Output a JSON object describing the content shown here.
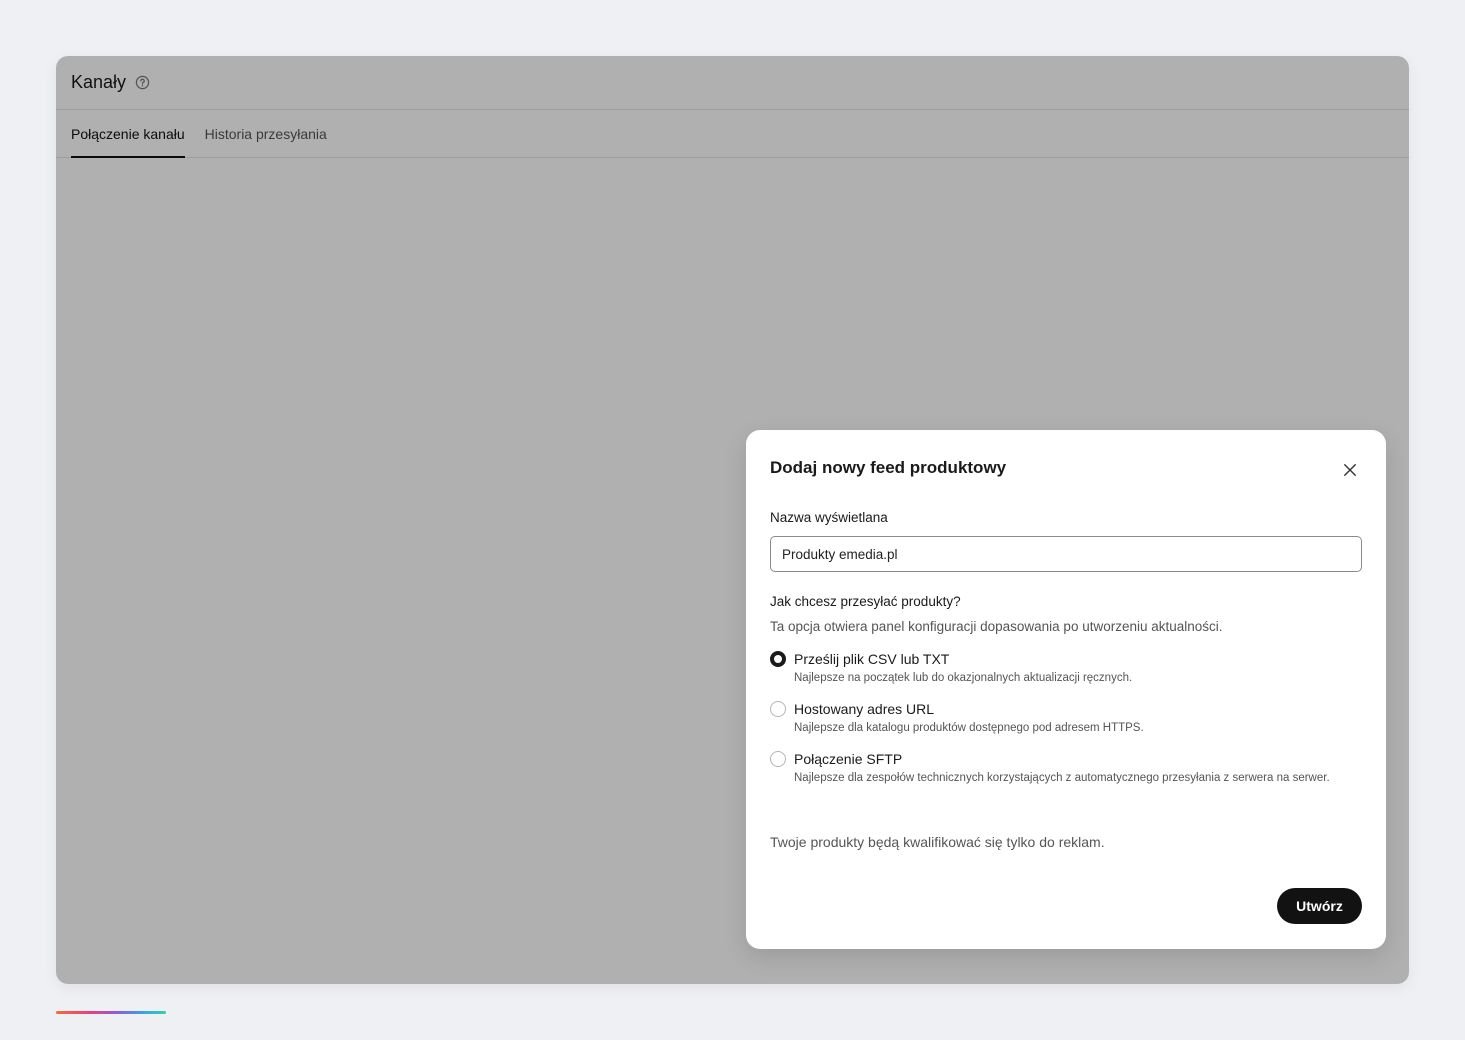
{
  "header": {
    "title": "Kanały",
    "help_icon": "help-circle-icon"
  },
  "tabs": [
    {
      "label": "Połączenie kanału",
      "active": true
    },
    {
      "label": "Historia przesyłania",
      "active": false
    }
  ],
  "modal": {
    "title": "Dodaj nowy feed produktowy",
    "close_icon": "close-icon",
    "name_field": {
      "label": "Nazwa wyświetlana",
      "value": "Produkty emedia.pl"
    },
    "upload_question": "Jak chcesz przesyłać produkty?",
    "upload_hint": "Ta opcja otwiera panel konfiguracji dopasowania po utworzeniu aktualności.",
    "options": [
      {
        "label": "Prześlij plik CSV lub TXT",
        "description": "Najlepsze na początek lub do okazjonalnych aktualizacji ręcznych.",
        "selected": true
      },
      {
        "label": "Hostowany adres URL",
        "description": "Najlepsze dla katalogu produktów dostępnego pod adresem HTTPS.",
        "selected": false
      },
      {
        "label": "Połączenie SFTP",
        "description": "Najlepsze dla zespołów technicznych korzystających z automatycznego przesyłania z serwera na serwer.",
        "selected": false
      }
    ],
    "footer_note": "Twoje produkty będą kwalifikować się tylko do reklam.",
    "create_button": "Utwórz"
  },
  "colors": {
    "background": "#eff0f4",
    "primary_button": "#121212",
    "overlay": "rgba(0,0,0,0.31)"
  }
}
